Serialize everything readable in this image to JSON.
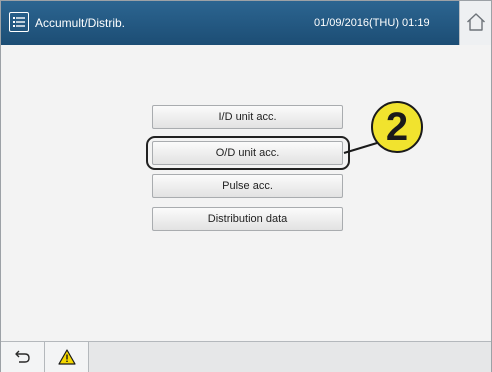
{
  "header": {
    "title": "Accumult/Distrib.",
    "datetime": "01/09/2016(THU) 01:19",
    "menu_icon": "list-menu-icon",
    "home_icon": "home-icon"
  },
  "main": {
    "buttons": [
      {
        "label": "I/D unit acc."
      },
      {
        "label": "O/D unit acc.",
        "highlighted": true
      },
      {
        "label": "Pulse acc."
      },
      {
        "label": "Distribution data"
      }
    ],
    "step_badge": "2"
  },
  "footer": {
    "back_icon": "back-arrow-icon",
    "warning_icon": "warning-icon"
  },
  "colors": {
    "titlebar": "#1f5580",
    "badge": "#f1e32e",
    "warning": "#f5d800"
  }
}
